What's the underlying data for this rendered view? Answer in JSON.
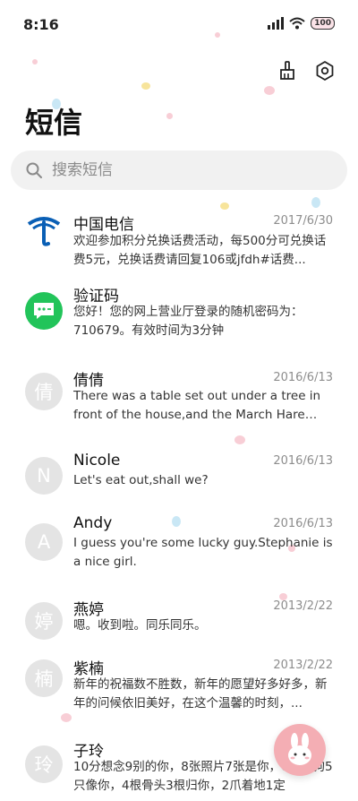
{
  "status": {
    "time": "8:16",
    "battery": "100"
  },
  "header": {
    "title": "短信"
  },
  "search": {
    "placeholder": "搜索短信"
  },
  "messages": [
    {
      "name": "中国电信",
      "date": "2017/6/30",
      "avatar_letter": "",
      "preview": "欢迎参加积分兑换话费活动，每500分可兑换话费5元，兑换话费请回复106或jfdh#话费..."
    },
    {
      "name": "验证码",
      "date": "",
      "avatar_letter": "",
      "preview": "您好！您的网上营业厅登录的随机密码为：710679。有效时间为3分钟"
    },
    {
      "name": "倩倩",
      "date": "2016/6/13",
      "avatar_letter": "倩",
      "preview": "There was a table set out under a tree in front of the house,and the March Hare an..."
    },
    {
      "name": "Nicole",
      "date": "2016/6/13",
      "avatar_letter": "N",
      "preview": "Let's eat out,shall we?"
    },
    {
      "name": "Andy",
      "date": "2016/6/13",
      "avatar_letter": "A",
      "preview": "I guess you're some lucky guy.Stephanie is a nice girl."
    },
    {
      "name": "燕婷",
      "date": "2013/2/22",
      "avatar_letter": "婷",
      "preview": "嗯。收到啦。同乐同乐。"
    },
    {
      "name": "紫楠",
      "date": "2013/2/22",
      "avatar_letter": "楠",
      "preview": "新年的祝福数不胜数，新年的愿望好多好多，新年的问候依旧美好，在这个温馨的时刻，..."
    },
    {
      "name": "子玲",
      "date": "",
      "avatar_letter": "玲",
      "preview": "10分想念9别的你，8张照片7张是你，6只小狗5只像你，4根骨头3根归你，2爪着地1定"
    }
  ],
  "colors": {
    "accent_pink": "#f4aeb4",
    "telecom_blue": "#0a5fb5",
    "otp_green": "#22c45a"
  },
  "icons": [
    "signal-icon",
    "wifi-icon",
    "battery-icon",
    "broom-icon",
    "settings-gear-icon",
    "search-icon",
    "rabbit-icon"
  ]
}
